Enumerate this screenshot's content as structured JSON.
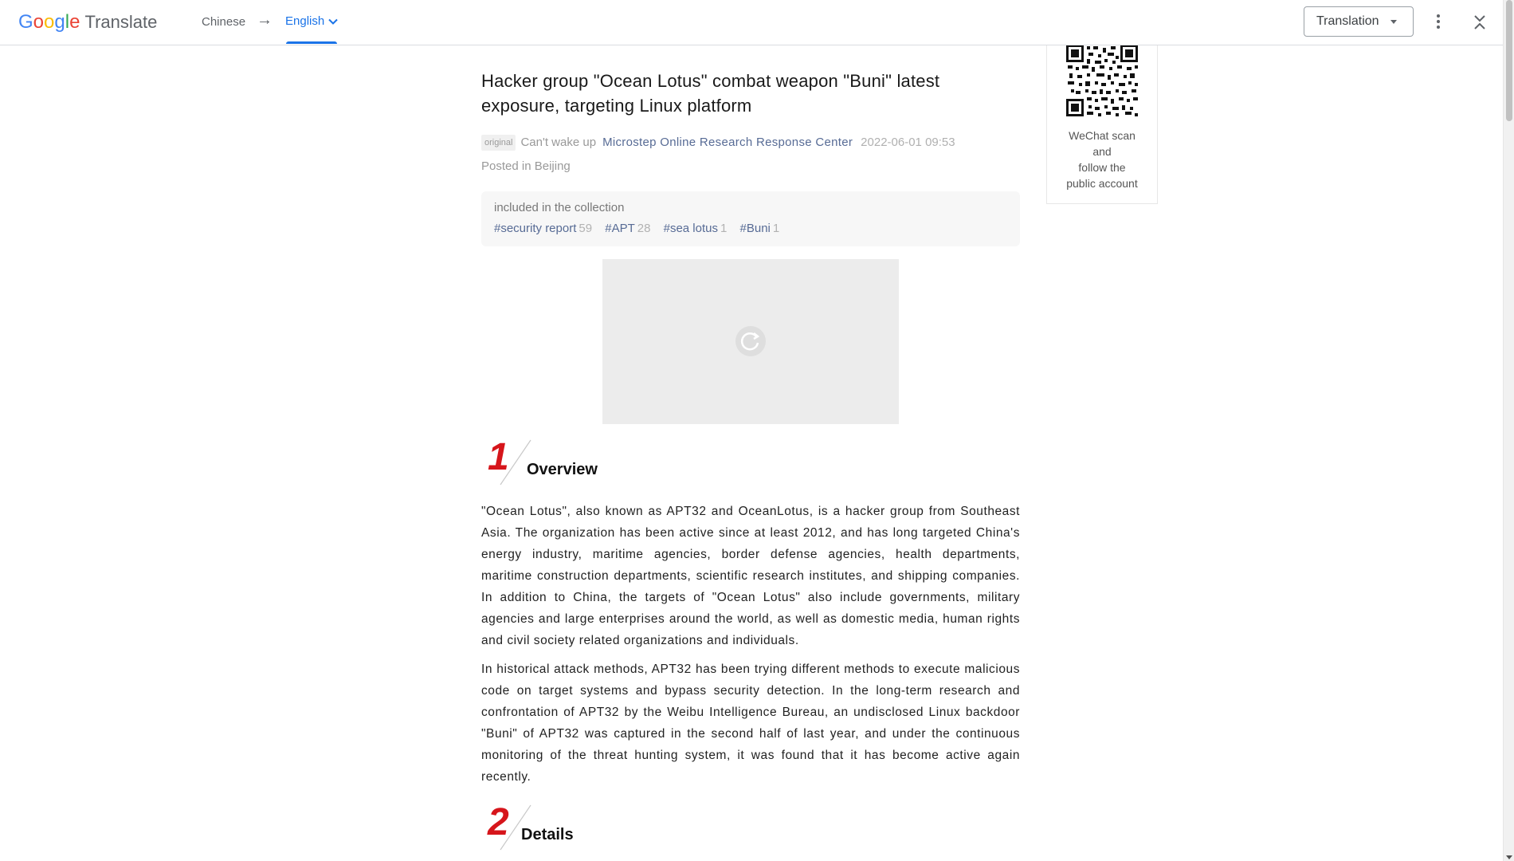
{
  "gt_bar": {
    "logo_google": [
      "G",
      "o",
      "o",
      "g",
      "l",
      "e"
    ],
    "logo_word": "Translate",
    "source_language": "Chinese",
    "arrow": "→",
    "target_language": "English",
    "view_mode": "Translation",
    "icons": [
      "chevron-down-icon",
      "more-vert-icon",
      "collapse-icon"
    ],
    "colors": {
      "accent": "#1a73e8",
      "g_blue": "#4285f4",
      "g_red": "#ea4335",
      "g_yellow": "#fbbc05",
      "g_green": "#34a853"
    }
  },
  "sidebar": {
    "qr_caption_line1": "WeChat scan",
    "qr_caption_line2": "and",
    "qr_caption_line3": "follow the",
    "qr_caption_line4": "public account"
  },
  "article": {
    "title": "Hacker group \"Ocean Lotus\" combat weapon \"Buni\" latest exposure, targeting Linux platform",
    "badge": "original",
    "author": "Can't wake up",
    "account": "Microstep Online Research Response Center",
    "date": "2022-06-01 09:53",
    "posted_in_label": "Posted in",
    "location": "Beijing",
    "collection": {
      "label": "included in the collection",
      "tags": [
        {
          "name": "#security report",
          "count": "59"
        },
        {
          "name": "#APT",
          "count": "28"
        },
        {
          "name": "#sea lotus",
          "count": "1"
        },
        {
          "name": "#Buni",
          "count": "1"
        }
      ]
    },
    "sections": [
      {
        "number": "1",
        "heading": "Overview",
        "paragraphs": [
          "\"Ocean Lotus\", also known as APT32 and OceanLotus, is a hacker group from Southeast Asia. The organization has been active since at least 2012, and has long targeted China's energy industry, maritime agencies, border defense agencies, health departments, maritime construction departments, scientific research institutes, and shipping companies. In addition to China, the targets of \"Ocean Lotus\" also include governments, military agencies and large enterprises around the world, as well as domestic media, human rights and civil society related organizations and individuals.",
          "In historical attack methods, APT32 has been trying different methods to execute malicious code on target systems and bypass security detection. In the long-term research and confrontation of APT32 by the Weibu Intelligence Bureau, an undisclosed Linux backdoor \"Buni\" of APT32 was captured in the second half of last year, and under the continuous monitoring of the threat hunting system, it was found that it has become active again recently."
        ]
      },
      {
        "number": "2",
        "heading": "Details"
      }
    ],
    "section_number_color": "#d6151b",
    "link_color": "#576b95"
  }
}
